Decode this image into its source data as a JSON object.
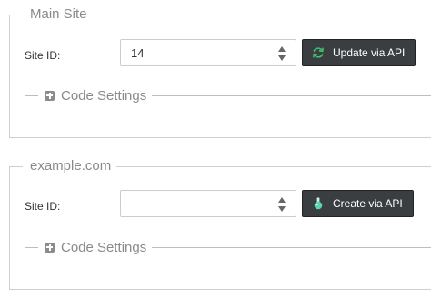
{
  "sites": [
    {
      "legend": "Main Site",
      "site_id_label": "Site ID:",
      "site_id_value": "14",
      "button_label": "Update via API",
      "button_icon": "refresh-icon",
      "button_icon_color": "#3fbf6a",
      "code_settings_label": "Code Settings"
    },
    {
      "legend": "example.com",
      "site_id_label": "Site ID:",
      "site_id_value": "",
      "button_label": "Create via API",
      "button_icon": "flask-icon",
      "button_icon_color": "#5bd6b0",
      "code_settings_label": "Code Settings"
    }
  ],
  "colors": {
    "button_bg": "#3b3e40",
    "legend_text": "#8a8a8a",
    "border": "#cfcfcf"
  }
}
